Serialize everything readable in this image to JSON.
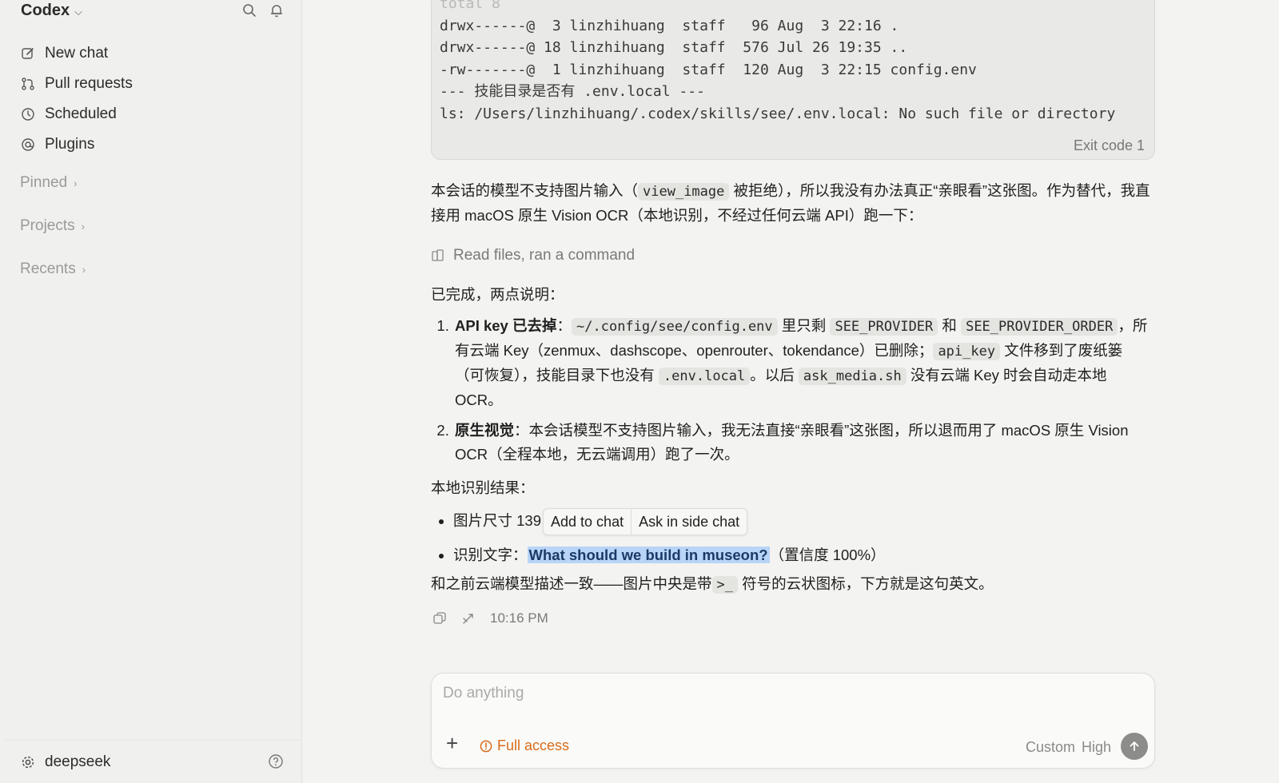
{
  "app": {
    "title": "Codex"
  },
  "sidebar": {
    "items": [
      {
        "label": "New chat",
        "icon": "edit-icon"
      },
      {
        "label": "Pull requests",
        "icon": "pull-request-icon"
      },
      {
        "label": "Scheduled",
        "icon": "clock-icon"
      },
      {
        "label": "Plugins",
        "icon": "plugin-icon"
      }
    ],
    "sections": {
      "pinned": "Pinned",
      "projects": "Projects",
      "recents": "Recents"
    },
    "footer": {
      "user": "deepseek"
    }
  },
  "terminal": {
    "faded_line": "total 8",
    "lines": [
      "drwx------@  3 linzhihuang  staff   96 Aug  3 22:16 .",
      "drwx------@ 18 linzhihuang  staff  576 Jul 26 19:35 ..",
      "-rw-------@  1 linzhihuang  staff  120 Aug  3 22:15 config.env",
      "--- 技能目录是否有 .env.local ---",
      "ls: /Users/linzhihuang/.codex/skills/see/.env.local: No such file or directory"
    ],
    "exit_code": "Exit code 1"
  },
  "message": {
    "intro_a": "本会话的模型不支持图片输入（",
    "intro_code": "view_image",
    "intro_b": "被拒绝），所以我没有办法真正“亲眼看”这张图。作为替代，我直接用 macOS 原生 Vision OCR（本地识别，不经过任何云端 API）跑一下：",
    "activity": "Read files, ran a command",
    "done": "已完成，两点说明：",
    "point1": {
      "lead": "API key 已去掉",
      "colon": "：",
      "code1": "~/.config/see/config.env",
      "t1": "里只剩",
      "code2": "SEE_PROVIDER",
      "t2": "和",
      "code3": "SEE_PROVIDER_ORDER",
      "t3": "，所有云端 Key（zenmux、dashscope、openrouter、tokendance）已删除；",
      "code4": "api_key",
      "t4": "文件移到了废纸篓（可恢复），技能目录下也没有",
      "code5": ".env.local",
      "t5": "。以后",
      "code6": "ask_media.sh",
      "t6": "没有云端 Key 时会自动走本地 OCR。"
    },
    "point2": {
      "lead": "原生视觉",
      "text": "：本会话模型不支持图片输入，我无法直接“亲眼看”这张图，所以退而用了 macOS 原生 Vision OCR（全程本地，无云端调用）跑了一次。"
    },
    "results_title": "本地识别结果：",
    "result1": "图片尺寸 139",
    "popup": {
      "add": "Add to chat",
      "ask": "Ask in side chat"
    },
    "result2_label": "识别文字：",
    "result2_text": "What should we build in museon?",
    "result2_conf": "（置信度 100%）",
    "closing_a": "和之前云端模型描述一致——图片中央是带",
    "closing_code": ">_",
    "closing_b": "符号的云状图标，下方就是这句英文。",
    "time": "10:16 PM"
  },
  "composer": {
    "placeholder": "Do anything",
    "access": "Full access",
    "model": "Custom",
    "effort": "High"
  },
  "colors": {
    "accent_orange": "#d86b1a",
    "highlight": "#b8d4f7"
  }
}
